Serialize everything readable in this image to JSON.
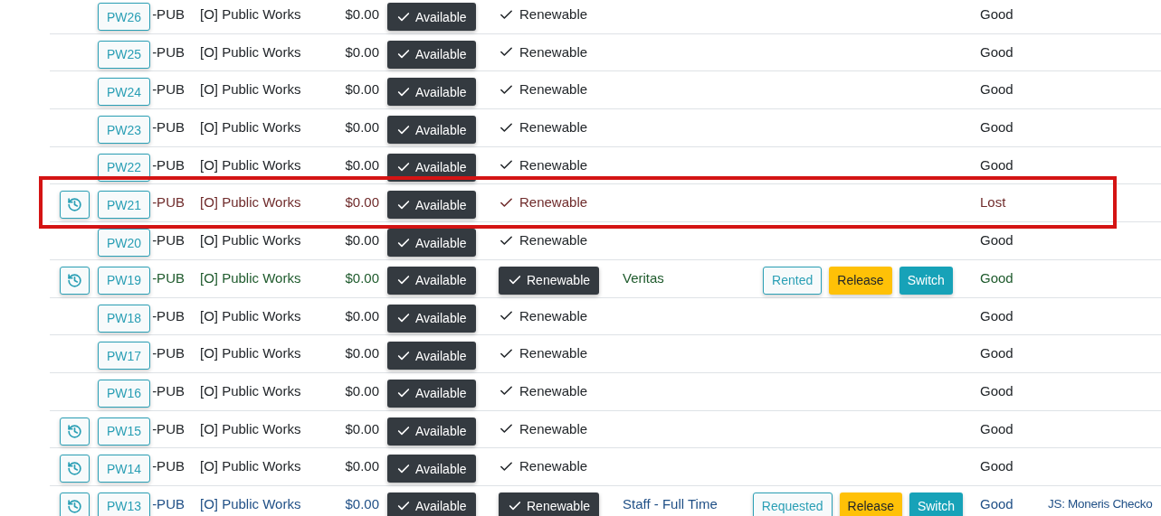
{
  "rows": [
    {
      "history": false,
      "code": "PW26",
      "suffix": "-PUB",
      "department": "[O] Public Works",
      "price": "$0.00",
      "availability": "Available",
      "renewable": {
        "label": "Renewable",
        "kind": "check"
      },
      "condition": "Good",
      "color": "#212529",
      "highlighted": false
    },
    {
      "history": false,
      "code": "PW25",
      "suffix": "-PUB",
      "department": "[O] Public Works",
      "price": "$0.00",
      "availability": "Available",
      "renewable": {
        "label": "Renewable",
        "kind": "check"
      },
      "condition": "Good",
      "color": "#212529",
      "highlighted": false
    },
    {
      "history": false,
      "code": "PW24",
      "suffix": "-PUB",
      "department": "[O] Public Works",
      "price": "$0.00",
      "availability": "Available",
      "renewable": {
        "label": "Renewable",
        "kind": "check"
      },
      "condition": "Good",
      "color": "#212529",
      "highlighted": false
    },
    {
      "history": false,
      "code": "PW23",
      "suffix": "-PUB",
      "department": "[O] Public Works",
      "price": "$0.00",
      "availability": "Available",
      "renewable": {
        "label": "Renewable",
        "kind": "check"
      },
      "condition": "Good",
      "color": "#212529",
      "highlighted": false
    },
    {
      "history": false,
      "code": "PW22",
      "suffix": "-PUB",
      "department": "[O] Public Works",
      "price": "$0.00",
      "availability": "Available",
      "renewable": {
        "label": "Renewable",
        "kind": "check"
      },
      "condition": "Good",
      "color": "#212529",
      "highlighted": false
    },
    {
      "history": true,
      "code": "PW21",
      "suffix": "-PUB",
      "department": "[O] Public Works",
      "price": "$0.00",
      "availability": "Available",
      "renewable": {
        "label": "Renewable",
        "kind": "check"
      },
      "condition": "Lost",
      "color": "#6f2b2b",
      "highlighted": true
    },
    {
      "history": false,
      "code": "PW20",
      "suffix": "-PUB",
      "department": "[O] Public Works",
      "price": "$0.00",
      "availability": "Available",
      "renewable": {
        "label": "Renewable",
        "kind": "check"
      },
      "condition": "Good",
      "color": "#212529",
      "highlighted": false
    },
    {
      "history": true,
      "code": "PW19",
      "suffix": "-PUB",
      "department": "[O] Public Works",
      "price": "$0.00",
      "availability": "Available",
      "renewable": {
        "label": "Renewable",
        "kind": "button"
      },
      "holder": "Veritas",
      "status": "Rented",
      "actions": [
        "Release",
        "Switch"
      ],
      "condition": "Good",
      "color": "#1e5a2c",
      "highlighted": false
    },
    {
      "history": false,
      "code": "PW18",
      "suffix": "-PUB",
      "department": "[O] Public Works",
      "price": "$0.00",
      "availability": "Available",
      "renewable": {
        "label": "Renewable",
        "kind": "check"
      },
      "condition": "Good",
      "color": "#212529",
      "highlighted": false
    },
    {
      "history": false,
      "code": "PW17",
      "suffix": "-PUB",
      "department": "[O] Public Works",
      "price": "$0.00",
      "availability": "Available",
      "renewable": {
        "label": "Renewable",
        "kind": "check"
      },
      "condition": "Good",
      "color": "#212529",
      "highlighted": false
    },
    {
      "history": false,
      "code": "PW16",
      "suffix": "-PUB",
      "department": "[O] Public Works",
      "price": "$0.00",
      "availability": "Available",
      "renewable": {
        "label": "Renewable",
        "kind": "check"
      },
      "condition": "Good",
      "color": "#212529",
      "highlighted": false
    },
    {
      "history": true,
      "code": "PW15",
      "suffix": "-PUB",
      "department": "[O] Public Works",
      "price": "$0.00",
      "availability": "Available",
      "renewable": {
        "label": "Renewable",
        "kind": "check"
      },
      "condition": "Good",
      "color": "#212529",
      "highlighted": false
    },
    {
      "history": true,
      "code": "PW14",
      "suffix": "-PUB",
      "department": "[O] Public Works",
      "price": "$0.00",
      "availability": "Available",
      "renewable": {
        "label": "Renewable",
        "kind": "check"
      },
      "condition": "Good",
      "color": "#212529",
      "highlighted": false
    },
    {
      "history": true,
      "code": "PW13",
      "suffix": "-PUB",
      "department": "[O] Public Works",
      "price": "$0.00",
      "availability": "Available",
      "renewable": {
        "label": "Renewable",
        "kind": "button"
      },
      "holder": "Staff - Full Time",
      "status": "Requested",
      "actions": [
        "Release",
        "Switch"
      ],
      "condition": "Good",
      "note": "JS: Moneris Checko",
      "color": "#1f4f86",
      "highlighted": false
    }
  ]
}
